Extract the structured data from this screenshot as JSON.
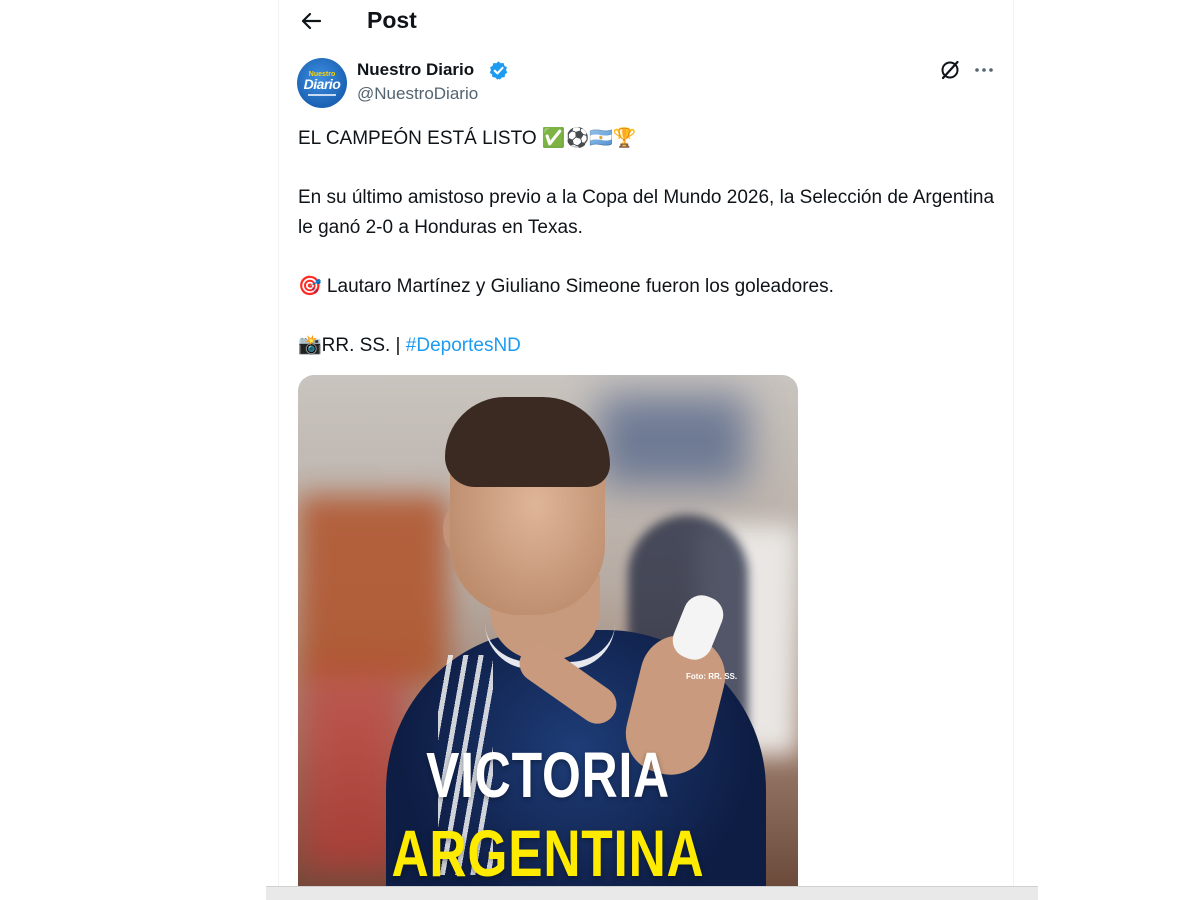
{
  "header": {
    "title": "Post",
    "back_icon": "arrow-left-icon"
  },
  "tweet": {
    "author": {
      "name": "Nuestro Diario",
      "handle": "@NuestroDiario",
      "verified": true,
      "verified_color": "#1d9bf0",
      "avatar": {
        "small_text": "Nuestro",
        "word": "Diario",
        "bg_color": "#1b62b4",
        "accent_color": "#ffd400"
      }
    },
    "actions": {
      "grok_icon": "grok-icon",
      "more_icon": "more-horizontal-icon"
    },
    "text": {
      "line1": "EL CAMPEÓN ESTÁ LISTO ✅⚽🇦🇷🏆",
      "line2": "En su último amistoso previo a la Copa del Mundo 2026, la Selección de Argentina le ganó 2-0 a Honduras en Texas.",
      "line3": "🎯 Lautaro Martínez y Giuliano Simeone fueron los goleadores.",
      "line4_prefix": "📸RR. SS. | ",
      "hashtag": "#DeportesND"
    },
    "media": {
      "headline_1": "VICTORIA",
      "headline_2": "ARGENTINA",
      "photo_credit": "Foto: RR. SS.",
      "headline_1_color": "#ffffff",
      "headline_2_color": "#ffeb00"
    }
  },
  "colors": {
    "link": "#1d9bf0",
    "secondary_text": "#536471",
    "primary_text": "#0f1419"
  }
}
